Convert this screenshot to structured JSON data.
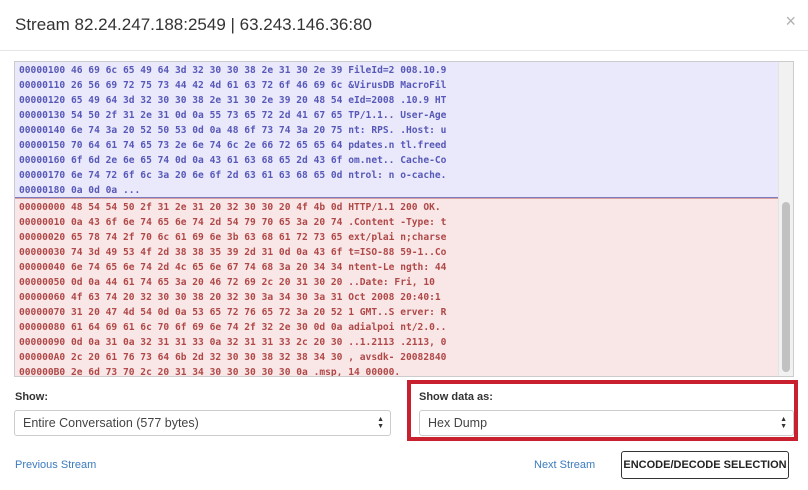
{
  "modal": {
    "title": "Stream 82.24.247.188:2549 | 63.243.146.36:80",
    "close_glyph": "×"
  },
  "dump": {
    "client_lines": [
      "00000100 46 69 6c 65 49 64 3d 32 30 30 38 2e 31 30 2e 39 FileId=2 008.10.9",
      "00000110 26 56 69 72 75 73 44 42 4d 61 63 72 6f 46 69 6c &VirusDB MacroFil",
      "00000120 65 49 64 3d 32 30 30 38 2e 31 30 2e 39 20 48 54 eId=2008 .10.9 HT",
      "00000130 54 50 2f 31 2e 31 0d 0a 55 73 65 72 2d 41 67 65 TP/1.1.. User-Age",
      "00000140 6e 74 3a 20 52 50 53 0d 0a 48 6f 73 74 3a 20 75 nt: RPS. .Host: u",
      "00000150 70 64 61 74 65 73 2e 6e 74 6c 2e 66 72 65 65 64 pdates.n tl.freed",
      "00000160 6f 6d 2e 6e 65 74 0d 0a 43 61 63 68 65 2d 43 6f om.net.. Cache-Co",
      "00000170 6e 74 72 6f 6c 3a 20 6e 6f 2d 63 61 63 68 65 0d ntrol: n o-cache.",
      "00000180 0a 0d 0a ..."
    ],
    "server_lines": [
      "00000000 48 54 54 50 2f 31 2e 31 20 32 30 30 20 4f 4b 0d HTTP/1.1 200 OK.",
      "00000010 0a 43 6f 6e 74 65 6e 74 2d 54 79 70 65 3a 20 74 .Content -Type: t",
      "00000020 65 78 74 2f 70 6c 61 69 6e 3b 63 68 61 72 73 65 ext/plai n;charse",
      "00000030 74 3d 49 53 4f 2d 38 38 35 39 2d 31 0d 0a 43 6f t=ISO-88 59-1..Co",
      "00000040 6e 74 65 6e 74 2d 4c 65 6e 67 74 68 3a 20 34 34 ntent-Le ngth: 44",
      "00000050 0d 0a 44 61 74 65 3a 20 46 72 69 2c 20 31 30 20 ..Date: Fri, 10",
      "00000060 4f 63 74 20 32 30 30 38 20 32 30 3a 34 30 3a 31 Oct 2008 20:40:1",
      "00000070 31 20 47 4d 54 0d 0a 53 65 72 76 65 72 3a 20 52 1 GMT..S erver: R",
      "00000080 61 64 69 61 6c 70 6f 69 6e 74 2f 32 2e 30 0d 0a adialpoi nt/2.0..",
      "00000090 0d 0a 31 0a 32 31 31 33 0a 32 31 31 33 2c 20 30 ..1.2113 .2113, 0",
      "000000A0 2c 20 61 76 73 64 6b 2d 32 30 30 38 32 38 34 30 , avsdk- 20082840",
      "000000B0 2e 6d 73 70 2c 20 31 34 30 30 30 30 30 0a .msp, 14 00000."
    ]
  },
  "show": {
    "label": "Show:",
    "selected": "Entire Conversation (577 bytes)"
  },
  "show_as": {
    "label": "Show data as:",
    "selected": "Hex Dump"
  },
  "footer": {
    "previous": "Previous Stream",
    "next": "Next Stream",
    "encode_button": "ENCODE/DECODE SELECTION"
  },
  "colors": {
    "client_text": "#5858b8",
    "client_bg": "#e9e9fb",
    "server_text": "#b04848",
    "server_bg": "#f9e7e7",
    "highlight_border": "#c8202f",
    "link": "#3b7bbf"
  }
}
